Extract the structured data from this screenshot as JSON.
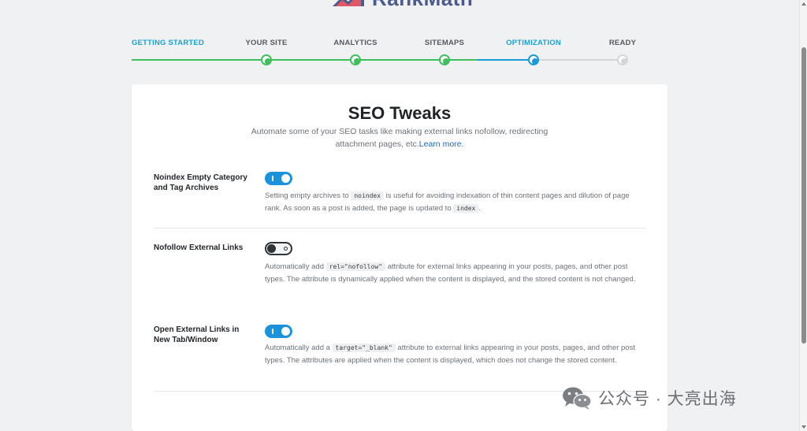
{
  "brand": {
    "name": "RankMath"
  },
  "steps": [
    {
      "label": "GETTING STARTED",
      "state": "done"
    },
    {
      "label": "YOUR SITE",
      "state": "done"
    },
    {
      "label": "ANALYTICS",
      "state": "done"
    },
    {
      "label": "SITEMAPS",
      "state": "done"
    },
    {
      "label": "OPTIMIZATION",
      "state": "active"
    },
    {
      "label": "READY",
      "state": "pending"
    }
  ],
  "card": {
    "title": "SEO Tweaks",
    "description": "Automate some of your SEO tasks like making external links nofollow, redirecting attachment pages, etc.",
    "learn_more": "Learn more.",
    "settings": [
      {
        "label": "Noindex Empty Category and Tag Archives",
        "enabled": true,
        "help_1": "Setting empty archives to ",
        "code_1": "noindex",
        "help_2": " is useful for avoiding indexation of thin content pages and dilution of page rank. As soon as a post is added, the page is updated to ",
        "code_2": "index",
        "help_3": "."
      },
      {
        "label": "Nofollow External Links",
        "enabled": false,
        "help_1": "Automatically add ",
        "code_1": "rel=\"nofollow\"",
        "help_2": " attribute for external links appearing in your posts, pages, and other post types. The attribute is dynamically applied when the content is displayed, and the stored content is not changed."
      },
      {
        "label": "Open External Links in New Tab/Window",
        "enabled": true,
        "help_1": "Automatically add a ",
        "code_1": "target=\"_blank\"",
        "help_2": " attribute to external links appearing in your posts, pages, and other post types. The attributes are applied when the content is displayed, which does not change the stored content."
      }
    ]
  },
  "watermark": {
    "text": "公众号 · 大亮出海"
  },
  "colors": {
    "accent": "#1a92dc",
    "done": "#3fbf5b",
    "pending": "#d4d6d9"
  }
}
